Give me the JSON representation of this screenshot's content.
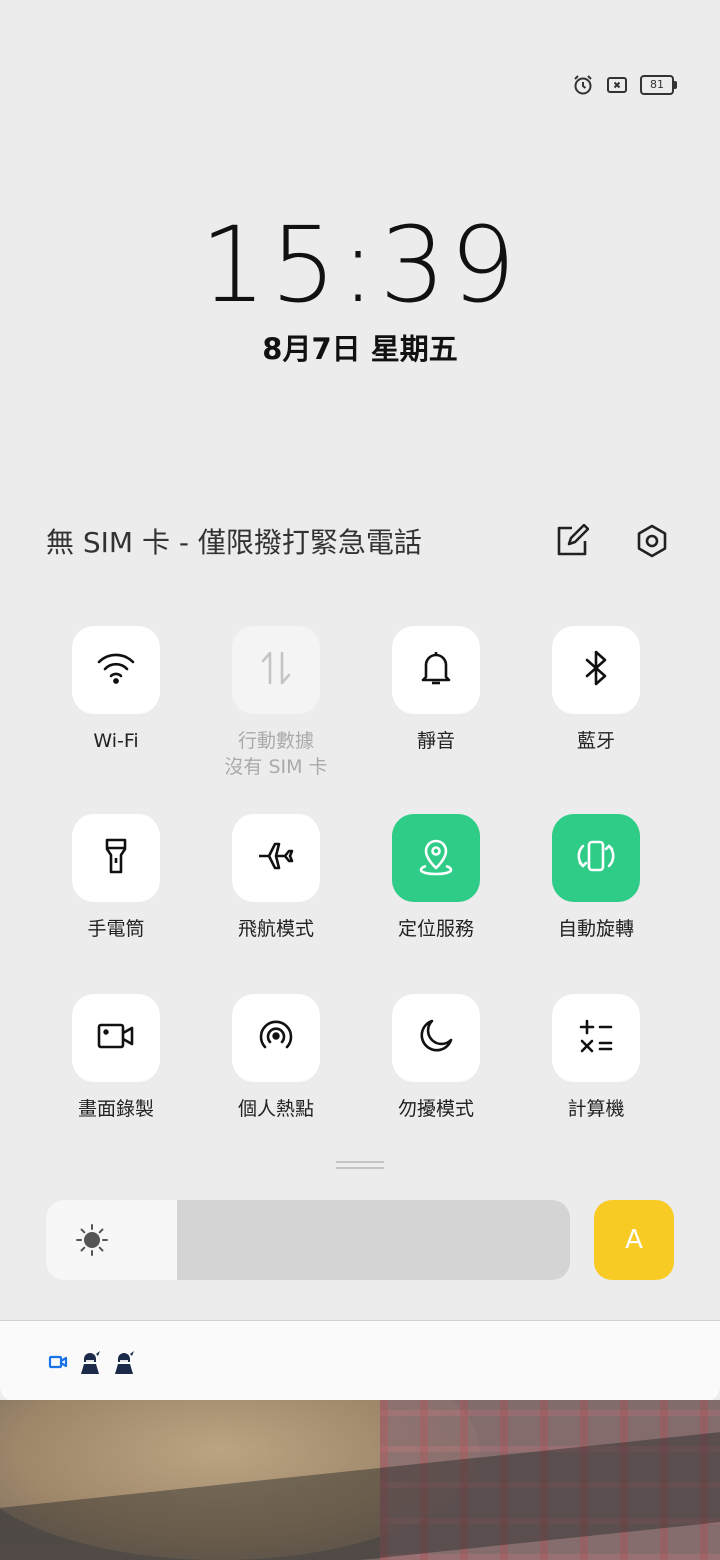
{
  "status_bar": {
    "icons": [
      "alarm-icon",
      "no-sim-icon",
      "battery-icon"
    ],
    "battery_level": "81"
  },
  "lock": {
    "time": "15:39",
    "date": "8月7日  星期五"
  },
  "sim_status": {
    "text": "無 SIM 卡 - 僅限撥打緊急電話",
    "icons": [
      "edit-icon",
      "settings-icon"
    ]
  },
  "tiles": [
    {
      "label": "Wi-Fi",
      "icon": "wifi-icon",
      "state": "on"
    },
    {
      "label": "行動數據",
      "sublabel": "沒有 SIM 卡",
      "icon": "mobile-data-icon",
      "state": "disabled"
    },
    {
      "label": "靜音",
      "icon": "bell-icon",
      "state": "off"
    },
    {
      "label": "藍牙",
      "icon": "bluetooth-icon",
      "state": "off"
    },
    {
      "label": "手電筒",
      "icon": "flashlight-icon",
      "state": "off"
    },
    {
      "label": "飛航模式",
      "icon": "airplane-icon",
      "state": "off"
    },
    {
      "label": "定位服務",
      "icon": "location-icon",
      "state": "active"
    },
    {
      "label": "自動旋轉",
      "icon": "rotate-icon",
      "state": "active"
    },
    {
      "label": "畫面錄製",
      "icon": "screen-record-icon",
      "state": "off"
    },
    {
      "label": "個人熱點",
      "icon": "hotspot-icon",
      "state": "off"
    },
    {
      "label": "勿擾模式",
      "icon": "moon-icon",
      "state": "off"
    },
    {
      "label": "計算機",
      "icon": "calculator-icon",
      "state": "off"
    }
  ],
  "brightness": {
    "level": 0.25,
    "auto_label": "A",
    "auto_color": "#f8ca24"
  },
  "colors": {
    "active_tile": "#2ecc87",
    "panel_bg": "#ececec"
  },
  "notifications": {
    "icons": [
      "video-camera-icon",
      "game-character-icon",
      "game-character-icon"
    ]
  }
}
